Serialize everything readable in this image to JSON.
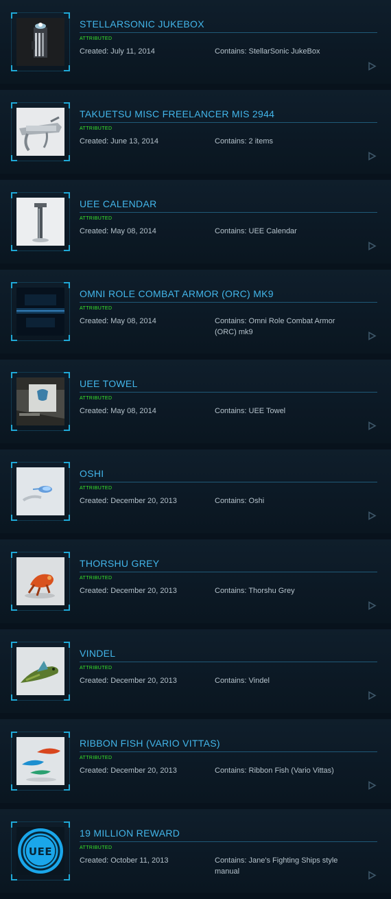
{
  "labels": {
    "created_prefix": "Created: ",
    "contains_prefix": "Contains: "
  },
  "colors": {
    "accent": "#43b6ea",
    "status": "#38e82a",
    "frame_corner": "#1fa9d7",
    "text": "#b6c3cc",
    "background": "#08121c"
  },
  "items": [
    {
      "title": "STELLARSONIC JUKEBOX",
      "status": "ATTRIBUTED",
      "created": "Created: July 11, 2014",
      "contains": "Contains: StellarSonic JukeBox",
      "thumbnail": "jukebox-image"
    },
    {
      "title": "TAKUETSU MISC FREELANCER MIS 2944",
      "status": "ATTRIBUTED",
      "created": "Created: June 13, 2014",
      "contains": "Contains: 2 items",
      "thumbnail": "freelancer-model-image"
    },
    {
      "title": "UEE CALENDAR",
      "status": "ATTRIBUTED",
      "created": "Created: May 08, 2014",
      "contains": "Contains: UEE Calendar",
      "thumbnail": "calendar-image"
    },
    {
      "title": "OMNI ROLE COMBAT ARMOR (ORC) MK9",
      "status": "ATTRIBUTED",
      "created": "Created: May 08, 2014",
      "contains": "Contains: Omni Role Combat Armor (ORC) mk9",
      "thumbnail": "armor-image"
    },
    {
      "title": "UEE TOWEL",
      "status": "ATTRIBUTED",
      "created": "Created: May 08, 2014",
      "contains": "Contains: UEE Towel",
      "thumbnail": "towel-image"
    },
    {
      "title": "OSHI",
      "status": "ATTRIBUTED",
      "created": "Created: December 20, 2013",
      "contains": "Contains: Oshi",
      "thumbnail": "oshi-fish-image"
    },
    {
      "title": "THORSHU GREY",
      "status": "ATTRIBUTED",
      "created": "Created: December 20, 2013",
      "contains": "Contains: Thorshu Grey",
      "thumbnail": "thorshu-image"
    },
    {
      "title": "VINDEL",
      "status": "ATTRIBUTED",
      "created": "Created: December 20, 2013",
      "contains": "Contains: Vindel",
      "thumbnail": "vindel-fish-image"
    },
    {
      "title": "RIBBON FISH (VARIO VITTAS)",
      "status": "ATTRIBUTED",
      "created": "Created: December 20, 2013",
      "contains": "Contains: Ribbon Fish (Vario Vittas)",
      "thumbnail": "ribbon-fish-image"
    },
    {
      "title": "19 MILLION REWARD",
      "status": "ATTRIBUTED",
      "created": "Created: October 11, 2013",
      "contains": "Contains: Jane's Fighting Ships style manual",
      "thumbnail": "uee-logo",
      "logo_text": "UEE"
    }
  ]
}
